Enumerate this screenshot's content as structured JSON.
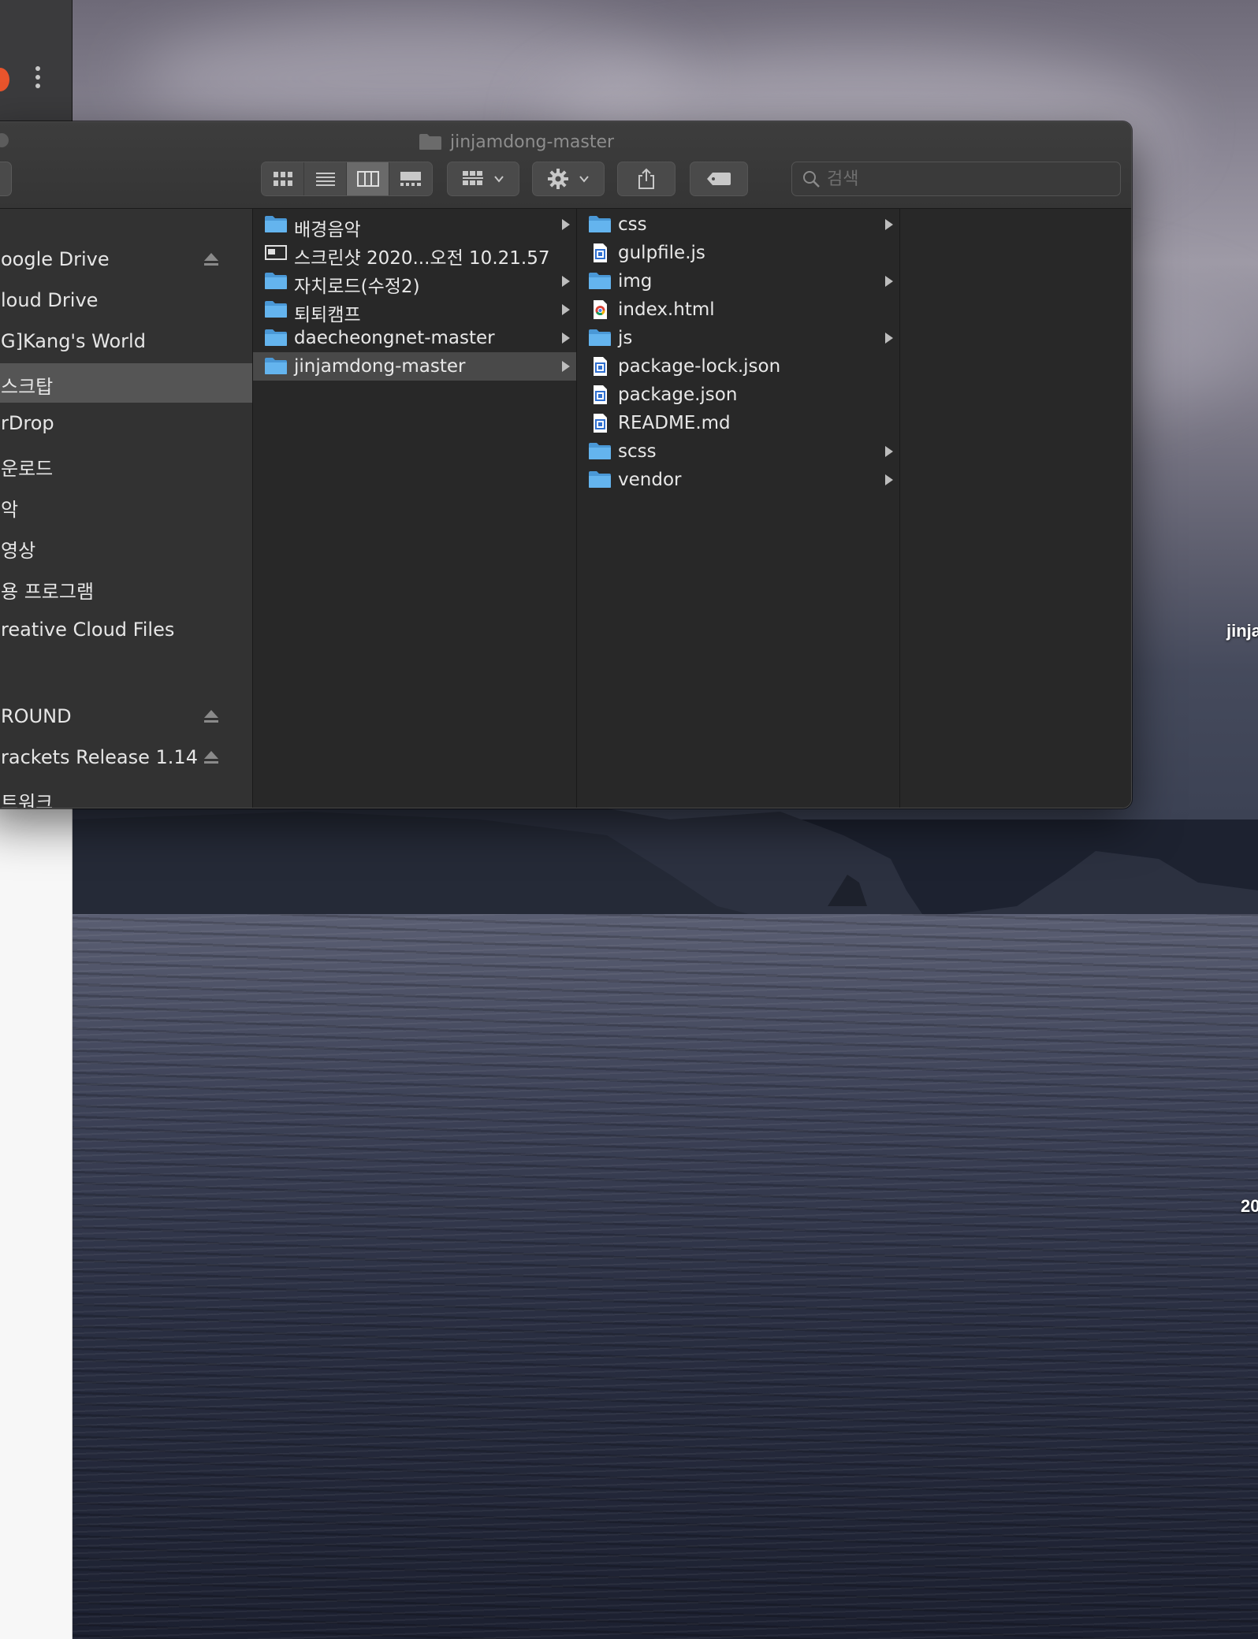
{
  "window": {
    "title": "jinjamdong-master"
  },
  "toolbar": {
    "search_placeholder": "검색",
    "view_modes": [
      "icon-view",
      "list-view",
      "column-view",
      "gallery-view"
    ],
    "active_view": "column-view"
  },
  "sidebar": {
    "items": [
      {
        "label": "oogle Drive",
        "eject": true,
        "selected": false
      },
      {
        "label": "loud Drive",
        "eject": false,
        "selected": false
      },
      {
        "label": "G]Kang's World",
        "eject": false,
        "selected": false
      },
      {
        "label": "스크탑",
        "eject": false,
        "selected": true
      },
      {
        "label": "rDrop",
        "eject": false,
        "selected": false
      },
      {
        "label": "운로드",
        "eject": false,
        "selected": false
      },
      {
        "label": "악",
        "eject": false,
        "selected": false
      },
      {
        "label": "영상",
        "eject": false,
        "selected": false
      },
      {
        "label": "용 프로그램",
        "eject": false,
        "selected": false
      },
      {
        "label": "reative Cloud Files",
        "eject": false,
        "selected": false
      },
      {
        "label": "ROUND",
        "eject": true,
        "selected": false
      },
      {
        "label": "rackets Release 1.14",
        "eject": true,
        "selected": false
      },
      {
        "label": "트워크",
        "eject": false,
        "selected": false
      }
    ]
  },
  "column1": {
    "items": [
      {
        "label": "배경음악",
        "type": "folder",
        "has_children": true,
        "selected": false
      },
      {
        "label": "스크린샷 2020...오전 10.21.57",
        "type": "screenshot",
        "has_children": false,
        "selected": false
      },
      {
        "label": "자치로드(수정2)",
        "type": "folder",
        "has_children": true,
        "selected": false
      },
      {
        "label": "퇴퇴캠프",
        "type": "folder",
        "has_children": true,
        "selected": false
      },
      {
        "label": "daecheongnet-master",
        "type": "folder",
        "has_children": true,
        "selected": false
      },
      {
        "label": "jinjamdong-master",
        "type": "folder",
        "has_children": true,
        "selected": true
      }
    ]
  },
  "column2": {
    "items": [
      {
        "label": "css",
        "type": "folder",
        "has_children": true
      },
      {
        "label": "gulpfile.js",
        "type": "file",
        "has_children": false
      },
      {
        "label": "img",
        "type": "folder",
        "has_children": true
      },
      {
        "label": "index.html",
        "type": "html",
        "has_children": false
      },
      {
        "label": "js",
        "type": "folder",
        "has_children": true
      },
      {
        "label": "package-lock.json",
        "type": "file",
        "has_children": false
      },
      {
        "label": "package.json",
        "type": "file",
        "has_children": false
      },
      {
        "label": "README.md",
        "type": "file",
        "has_children": false
      },
      {
        "label": "scss",
        "type": "folder",
        "has_children": true
      },
      {
        "label": "vendor",
        "type": "folder",
        "has_children": true
      }
    ]
  },
  "desktop": {
    "labels": [
      "jinja",
      "20"
    ]
  },
  "colors": {
    "folder_blue": "#5ab0e8",
    "selected_row": "#494949",
    "sidebar_selected": "#555555"
  }
}
